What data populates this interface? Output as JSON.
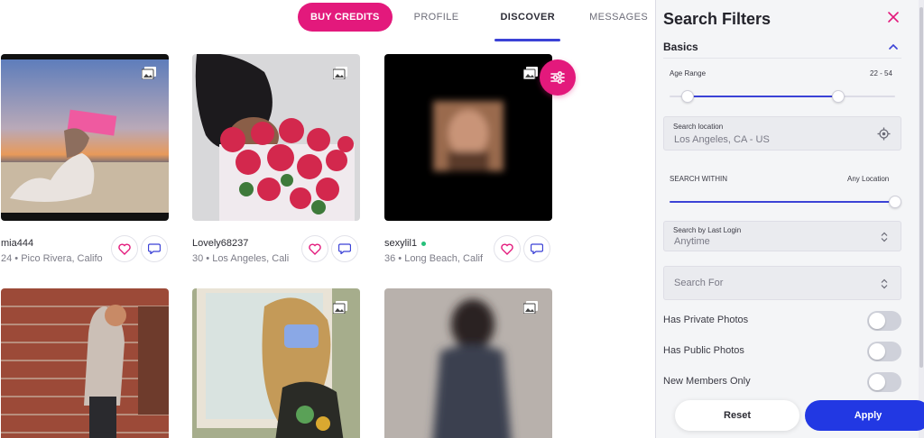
{
  "nav": {
    "buy_credits": "BUY CREDITS",
    "profile": "PROFILE",
    "discover": "DISCOVER",
    "messages": "MESSAGES",
    "active": "discover"
  },
  "profiles": [
    {
      "username": "mia444",
      "meta": "24 • Pico Rivera, Califo",
      "online": false
    },
    {
      "username": "Lovely68237",
      "meta": "30 • Los Angeles, Cali",
      "online": false
    },
    {
      "username": "sexylil1",
      "meta": "36 • Long Beach, Calif",
      "online": true
    }
  ],
  "filters": {
    "title": "Search Filters",
    "section": "Basics",
    "age_range": {
      "label": "Age Range",
      "value": "22 - 54",
      "min": 22,
      "max": 54
    },
    "location": {
      "label": "Search location",
      "value": "Los Angeles, CA - US"
    },
    "within": {
      "label": "SEARCH WITHIN",
      "value": "Any Location",
      "level": 1.0
    },
    "last_login": {
      "label": "Search by Last Login",
      "value": "Anytime"
    },
    "search_for": {
      "placeholder": "Search For"
    },
    "toggles": [
      {
        "label": "Has Private Photos",
        "on": false
      },
      {
        "label": "Has Public Photos",
        "on": false
      },
      {
        "label": "New Members Only",
        "on": false
      }
    ],
    "reset": "Reset",
    "apply": "Apply"
  },
  "colors": {
    "brand_pink": "#e3197c",
    "brand_blue": "#2238e3",
    "accent": "#3b42d6"
  }
}
